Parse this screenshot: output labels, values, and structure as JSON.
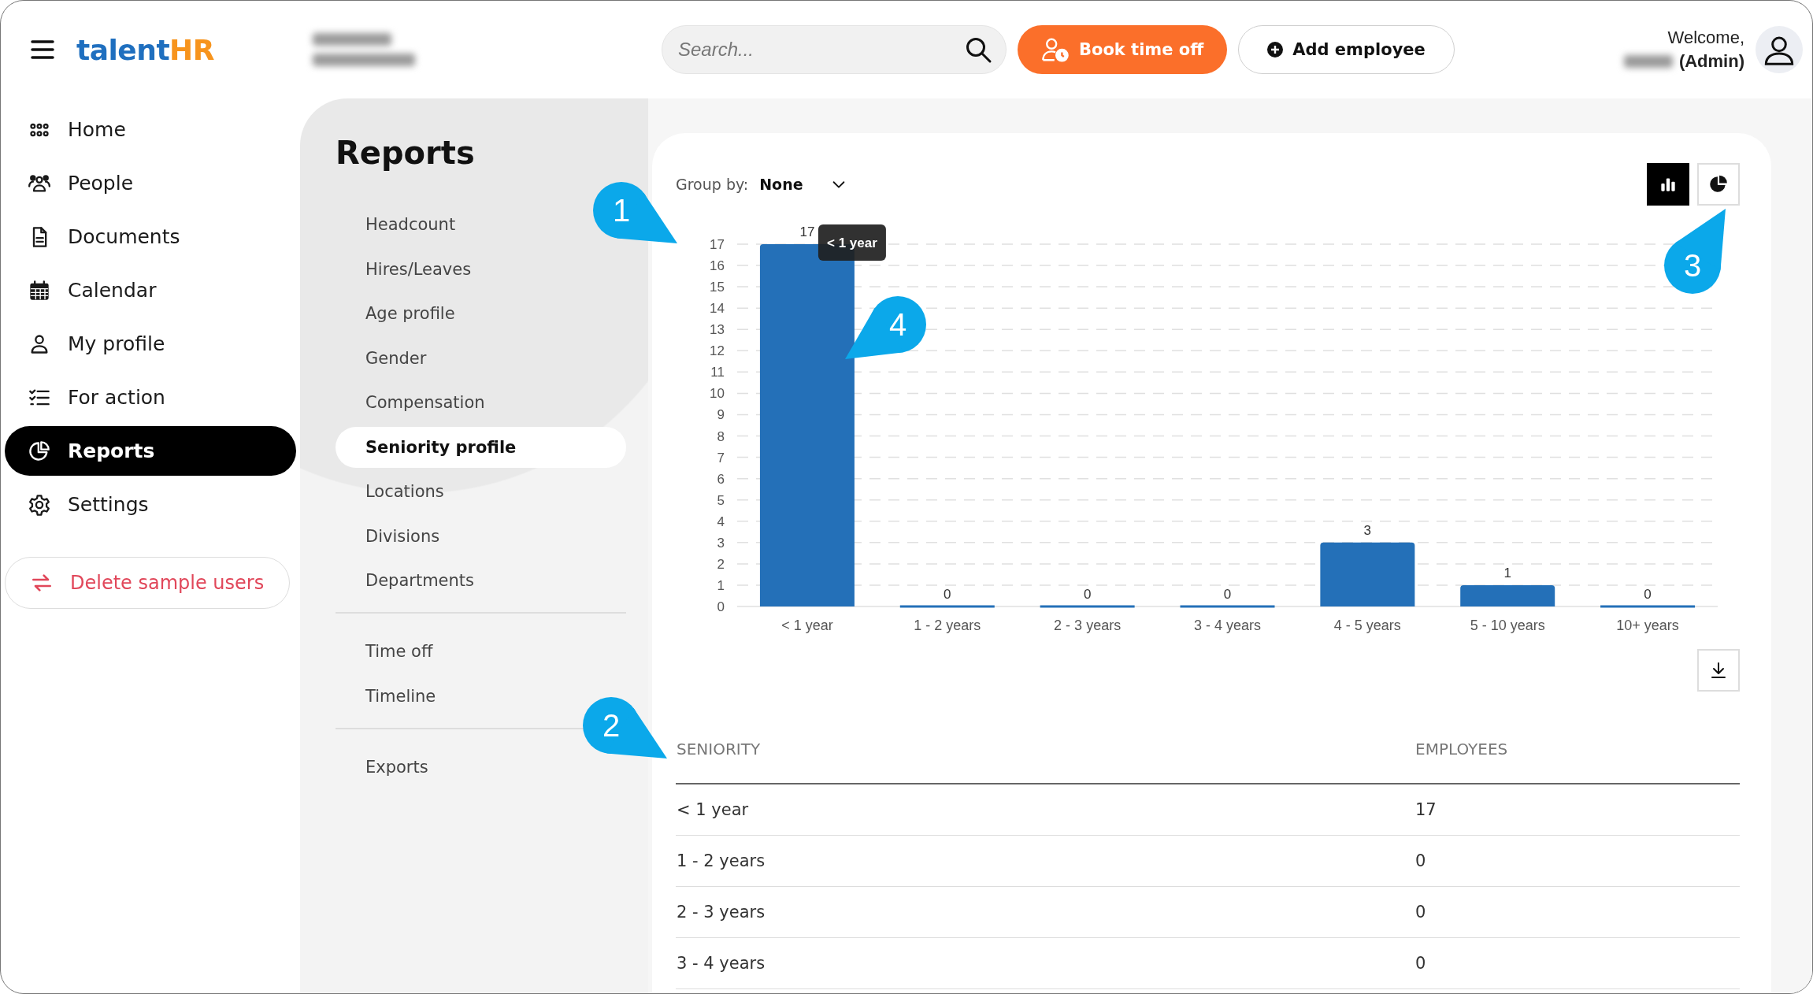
{
  "header": {
    "logo": {
      "text": "talent",
      "accent": "HR"
    },
    "search": {
      "placeholder": "Search..."
    },
    "book_button": "Book time off",
    "add_button": "Add employee",
    "welcome": "Welcome,",
    "role": "(Admin)"
  },
  "sidebar": {
    "items": [
      {
        "label": "Home",
        "selected": false
      },
      {
        "label": "People",
        "selected": false
      },
      {
        "label": "Documents",
        "selected": false
      },
      {
        "label": "Calendar",
        "selected": false
      },
      {
        "label": "My profile",
        "selected": false
      },
      {
        "label": "For action",
        "selected": false
      },
      {
        "label": "Reports",
        "selected": true
      },
      {
        "label": "Settings",
        "selected": false
      }
    ],
    "delete_button": "Delete sample users"
  },
  "reports_menu": {
    "title": "Reports",
    "groups": [
      [
        {
          "label": "Headcount",
          "selected": false
        },
        {
          "label": "Hires/Leaves",
          "selected": false
        },
        {
          "label": "Age profile",
          "selected": false
        },
        {
          "label": "Gender",
          "selected": false
        },
        {
          "label": "Compensation",
          "selected": false
        },
        {
          "label": "Seniority profile",
          "selected": true
        },
        {
          "label": "Locations",
          "selected": false
        },
        {
          "label": "Divisions",
          "selected": false
        },
        {
          "label": "Departments",
          "selected": false
        }
      ],
      [
        {
          "label": "Time off",
          "selected": false
        },
        {
          "label": "Timeline",
          "selected": false
        }
      ],
      [
        {
          "label": "Exports",
          "selected": false
        }
      ]
    ]
  },
  "report": {
    "group_by": {
      "label": "Group by:",
      "value": "None"
    },
    "chart_toggles": [
      {
        "selected": true
      },
      {
        "selected": false
      }
    ],
    "chart_data": {
      "type": "bar",
      "categories": [
        "< 1 year",
        "1 - 2 years",
        "2 - 3 years",
        "3 - 4 years",
        "4 - 5 years",
        "5 - 10 years",
        "10+ years"
      ],
      "series": [
        {
          "color": "#2470b8",
          "values": [
            17,
            0,
            0,
            0,
            3,
            1,
            0
          ]
        }
      ],
      "ylim": [
        0,
        17
      ],
      "yticks": [
        0,
        1,
        2,
        3,
        4,
        5,
        6,
        7,
        8,
        9,
        10,
        11,
        12,
        13,
        14,
        15,
        16,
        17
      ],
      "data_labels": true,
      "grid": true
    },
    "tooltip": "< 1 year",
    "table": {
      "columns": [
        "SENIORITY",
        "EMPLOYEES"
      ],
      "rows": [
        [
          "< 1 year",
          "17"
        ],
        [
          "1 - 2 years",
          "0"
        ],
        [
          "2 - 3 years",
          "0"
        ],
        [
          "3 - 4 years",
          "0"
        ]
      ]
    }
  },
  "callouts": [
    {
      "label": "1"
    },
    {
      "label": "2"
    },
    {
      "label": "3"
    },
    {
      "label": "4"
    }
  ]
}
